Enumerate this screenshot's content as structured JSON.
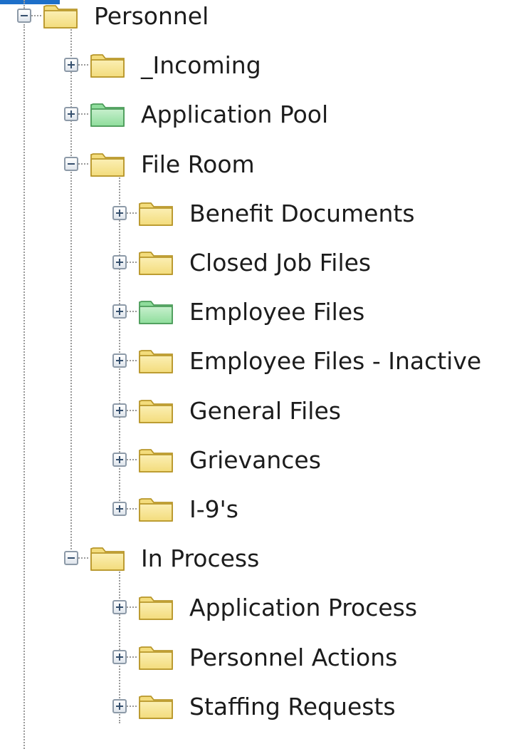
{
  "colors": {
    "folder_yellow": "#f3dc7c",
    "folder_green": "#8fdd9c",
    "selection_blue": "#1d6fc9"
  },
  "tree": {
    "root": {
      "label": "Personnel",
      "expanded": true,
      "icon": "folder-icon",
      "color": "yellow",
      "children": [
        {
          "label": "_Incoming",
          "expanded": false,
          "icon": "folder-icon",
          "color": "yellow"
        },
        {
          "label": "Application Pool",
          "expanded": false,
          "icon": "folder-icon",
          "color": "green"
        },
        {
          "label": "File Room",
          "expanded": true,
          "icon": "folder-icon",
          "color": "yellow",
          "children": [
            {
              "label": "Benefit Documents",
              "expanded": false,
              "icon": "folder-icon",
              "color": "yellow"
            },
            {
              "label": "Closed Job Files",
              "expanded": false,
              "icon": "folder-icon",
              "color": "yellow"
            },
            {
              "label": "Employee Files",
              "expanded": false,
              "icon": "folder-icon",
              "color": "green"
            },
            {
              "label": "Employee Files - Inactive",
              "expanded": false,
              "icon": "folder-icon",
              "color": "yellow"
            },
            {
              "label": "General Files",
              "expanded": false,
              "icon": "folder-icon",
              "color": "yellow"
            },
            {
              "label": "Grievances",
              "expanded": false,
              "icon": "folder-icon",
              "color": "yellow"
            },
            {
              "label": "I-9's",
              "expanded": false,
              "icon": "folder-icon",
              "color": "yellow"
            }
          ]
        },
        {
          "label": "In Process",
          "expanded": true,
          "icon": "folder-icon",
          "color": "yellow",
          "children": [
            {
              "label": "Application Process",
              "expanded": false,
              "icon": "folder-icon",
              "color": "yellow"
            },
            {
              "label": "Personnel Actions",
              "expanded": false,
              "icon": "folder-icon",
              "color": "yellow"
            },
            {
              "label": "Staffing Requests",
              "expanded": false,
              "icon": "folder-icon",
              "color": "yellow"
            }
          ]
        }
      ]
    }
  }
}
